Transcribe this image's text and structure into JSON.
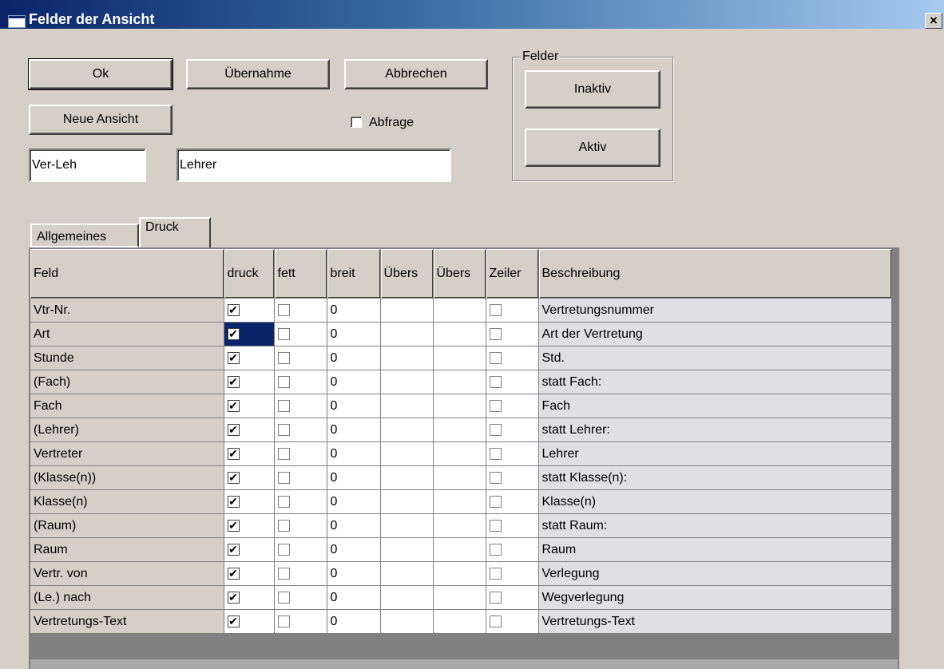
{
  "window": {
    "title": "Felder der Ansicht",
    "close_label": "×"
  },
  "buttons": {
    "ok": "Ok",
    "apply": "Übernahme",
    "cancel": "Abbrechen",
    "new_view": "Neue Ansicht"
  },
  "query_checkbox": {
    "label": "Abfrage",
    "checked": false
  },
  "fields_group": {
    "label": "Felder",
    "inactive": "Inaktiv",
    "active": "Aktiv"
  },
  "inputs": {
    "short_name": "Ver-Leh",
    "long_name": "Lehrer"
  },
  "tabs": [
    {
      "label": "Allgemeines",
      "active": false
    },
    {
      "label": "Druck",
      "active": true
    }
  ],
  "grid": {
    "columns": [
      "Feld",
      "druck",
      "fett",
      "breit",
      "Übers",
      "Übers",
      "Zeiler",
      "Beschreibung"
    ],
    "rows": [
      {
        "feld": "Vtr-Nr.",
        "druck": true,
        "fett": false,
        "breit": "0",
        "zeilen": false,
        "beschreibung": "Vertretungsnummer"
      },
      {
        "feld": "Art",
        "druck": true,
        "fett": false,
        "breit": "0",
        "zeilen": false,
        "beschreibung": "Art der Vertretung",
        "selected": true
      },
      {
        "feld": "Stunde",
        "druck": true,
        "fett": false,
        "breit": "0",
        "zeilen": false,
        "beschreibung": "Std."
      },
      {
        "feld": "(Fach)",
        "druck": true,
        "fett": false,
        "breit": "0",
        "zeilen": false,
        "beschreibung": "statt Fach:"
      },
      {
        "feld": "Fach",
        "druck": true,
        "fett": false,
        "breit": "0",
        "zeilen": false,
        "beschreibung": "Fach"
      },
      {
        "feld": "(Lehrer)",
        "druck": true,
        "fett": false,
        "breit": "0",
        "zeilen": false,
        "beschreibung": "statt Lehrer:"
      },
      {
        "feld": "Vertreter",
        "druck": true,
        "fett": false,
        "breit": "0",
        "zeilen": false,
        "beschreibung": "Lehrer"
      },
      {
        "feld": "(Klasse(n))",
        "druck": true,
        "fett": false,
        "breit": "0",
        "zeilen": false,
        "beschreibung": "statt Klasse(n):"
      },
      {
        "feld": "Klasse(n)",
        "druck": true,
        "fett": false,
        "breit": "0",
        "zeilen": false,
        "beschreibung": "Klasse(n)"
      },
      {
        "feld": "(Raum)",
        "druck": true,
        "fett": false,
        "breit": "0",
        "zeilen": false,
        "beschreibung": "statt Raum:"
      },
      {
        "feld": "Raum",
        "druck": true,
        "fett": false,
        "breit": "0",
        "zeilen": false,
        "beschreibung": "Raum"
      },
      {
        "feld": "Vertr. von",
        "druck": true,
        "fett": false,
        "breit": "0",
        "zeilen": false,
        "beschreibung": "Verlegung"
      },
      {
        "feld": "(Le.) nach",
        "druck": true,
        "fett": false,
        "breit": "0",
        "zeilen": false,
        "beschreibung": "Wegverlegung"
      },
      {
        "feld": "Vertretungs-Text",
        "druck": true,
        "fett": false,
        "breit": "0",
        "zeilen": false,
        "beschreibung": "Vertretungs-Text"
      }
    ]
  }
}
